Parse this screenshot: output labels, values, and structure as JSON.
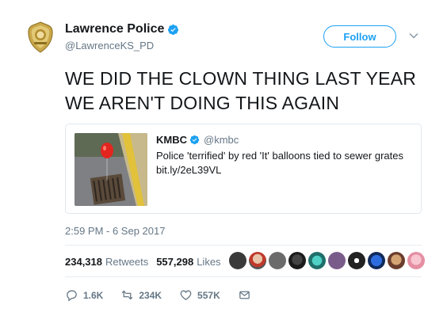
{
  "author": {
    "name": "Lawrence Police",
    "handle": "@LawrenceKS_PD"
  },
  "follow_label": "Follow",
  "tweet_lines": [
    "WE DID THE CLOWN THING LAST YEAR",
    "WE AREN'T DOING THIS AGAIN"
  ],
  "quote": {
    "name": "KMBC",
    "handle": "@kmbc",
    "text": "Police 'terrified' by red 'It' balloons tied to sewer grates",
    "link": "bit.ly/2eL39VL"
  },
  "timestamp": "2:59 PM - 6 Sep 2017",
  "stats": {
    "retweets": "234,318",
    "retweets_label": "Retweets",
    "likes": "557,298",
    "likes_label": "Likes"
  },
  "actions": {
    "reply_count": "1.6K",
    "retweet_count": "234K",
    "like_count": "557K"
  },
  "colors": {
    "accent": "#1da1f2",
    "muted": "#657786",
    "text": "#14171a"
  },
  "icons": [
    "police-badge-icon",
    "verified-icon",
    "chevron-down-icon",
    "reply-icon",
    "retweet-icon",
    "like-icon",
    "message-icon"
  ]
}
